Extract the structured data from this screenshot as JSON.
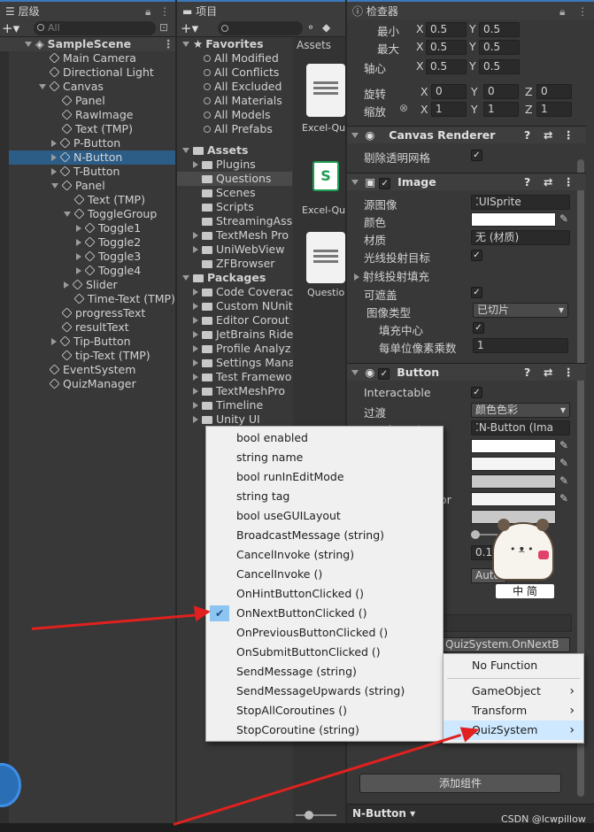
{
  "hierarchy": {
    "tab_label": "层级",
    "search_placeholder": "All",
    "scene_name": "SampleScene",
    "items": [
      {
        "label": "Main Camera",
        "indent": 0,
        "expand": "none"
      },
      {
        "label": "Directional Light",
        "indent": 0,
        "expand": "none"
      },
      {
        "label": "Canvas",
        "indent": 0,
        "expand": "open"
      },
      {
        "label": "Panel",
        "indent": 1,
        "expand": "none"
      },
      {
        "label": "RawImage",
        "indent": 1,
        "expand": "none"
      },
      {
        "label": "Text (TMP)",
        "indent": 1,
        "expand": "none"
      },
      {
        "label": "P-Button",
        "indent": 1,
        "expand": "closed"
      },
      {
        "label": "N-Button",
        "indent": 1,
        "expand": "closed",
        "selected": true
      },
      {
        "label": "T-Button",
        "indent": 1,
        "expand": "closed"
      },
      {
        "label": "Panel",
        "indent": 1,
        "expand": "open"
      },
      {
        "label": "Text (TMP)",
        "indent": 2,
        "expand": "none"
      },
      {
        "label": "ToggleGroup",
        "indent": 2,
        "expand": "open"
      },
      {
        "label": "Toggle1",
        "indent": 3,
        "expand": "closed"
      },
      {
        "label": "Toggle2",
        "indent": 3,
        "expand": "closed"
      },
      {
        "label": "Toggle3",
        "indent": 3,
        "expand": "closed"
      },
      {
        "label": "Toggle4",
        "indent": 3,
        "expand": "closed"
      },
      {
        "label": "Slider",
        "indent": 2,
        "expand": "closed"
      },
      {
        "label": "Time-Text (TMP)",
        "indent": 2,
        "expand": "none"
      },
      {
        "label": "progressText",
        "indent": 1,
        "expand": "none"
      },
      {
        "label": "resultText",
        "indent": 1,
        "expand": "none"
      },
      {
        "label": "Tip-Button",
        "indent": 1,
        "expand": "closed"
      },
      {
        "label": "tip-Text (TMP)",
        "indent": 1,
        "expand": "none"
      },
      {
        "label": "EventSystem",
        "indent": 0,
        "expand": "none"
      },
      {
        "label": "QuizManager",
        "indent": 0,
        "expand": "none"
      }
    ]
  },
  "project": {
    "tab_label": "项目",
    "favorites_label": "Favorites",
    "favorites": [
      "All Modified",
      "All Conflicts",
      "All Excluded",
      "All Materials",
      "All Models",
      "All Prefabs"
    ],
    "assets_label": "Assets",
    "assets": [
      {
        "label": "Plugins",
        "expand": "closed"
      },
      {
        "label": "Questions",
        "expand": "none",
        "selected": true
      },
      {
        "label": "Scenes",
        "expand": "none"
      },
      {
        "label": "Scripts",
        "expand": "none"
      },
      {
        "label": "StreamingAsse",
        "expand": "none"
      },
      {
        "label": "TextMesh Pro",
        "expand": "closed"
      },
      {
        "label": "UniWebView",
        "expand": "closed"
      },
      {
        "label": "ZFBrowser",
        "expand": "none"
      }
    ],
    "packages_label": "Packages",
    "packages": [
      "Code Coverac",
      "Custom NUnit",
      "Editor Corout",
      "JetBrains Ride",
      "Profile Analyz",
      "Settings Mana",
      "Test Framewo",
      "TextMeshPro",
      "Timeline",
      "Unity UI"
    ],
    "breadcrumb": "Assets",
    "files": [
      "Excel-Que",
      "Excel-Que",
      "Question"
    ]
  },
  "inspector": {
    "tab_label": "检查器",
    "rect": {
      "min_label": "最小",
      "max_label": "最大",
      "pivot_label": "轴心",
      "rotation_label": "旋转",
      "scale_label": "缩放",
      "min_x": "0.5",
      "min_y": "0.5",
      "max_x": "0.5",
      "max_y": "0.5",
      "pivot_x": "0.5",
      "pivot_y": "0.5",
      "rot_x": "0",
      "rot_y": "0",
      "rot_z": "0",
      "scale_x": "1",
      "scale_y": "1",
      "scale_z": "1",
      "x": "X",
      "y": "Y",
      "z": "Z"
    },
    "canvas_renderer": {
      "title": "Canvas Renderer",
      "cull_label": "剔除透明网格"
    },
    "image": {
      "title": "Image",
      "source_label": "源图像",
      "source_value": "UISprite",
      "color_label": "颜色",
      "material_label": "材质",
      "material_value": "无 (材质)",
      "raycast_label": "光线投射目标",
      "raycast_padding_label": "射线投射填充",
      "maskable_label": "可遮盖",
      "type_label": "图像类型",
      "type_value": "已切片",
      "fill_center_label": "填充中心",
      "ppu_label": "每单位像素乘数",
      "ppu_value": "1"
    },
    "button": {
      "title": "Button",
      "interactable_label": "Interactable",
      "transition_label": "过渡",
      "transition_value": "颜色色彩",
      "target_label": "目标图形",
      "target_value": "N-Button (Ima",
      "color_mult_partial": "or",
      "fade_value": "0.1",
      "auto_label": "Auto",
      "event_method": "QuizSystem.OnNextB"
    },
    "add_component": "添加组件",
    "footer_object": "N-Button"
  },
  "method_menu": {
    "items": [
      {
        "label": "bool enabled"
      },
      {
        "label": "string name"
      },
      {
        "label": "bool runInEditMode"
      },
      {
        "label": "string tag"
      },
      {
        "label": "bool useGUILayout"
      },
      {
        "label": "BroadcastMessage (string)"
      },
      {
        "label": "CancelInvoke (string)"
      },
      {
        "label": "CancelInvoke ()"
      },
      {
        "label": "OnHintButtonClicked ()"
      },
      {
        "label": "OnNextButtonClicked ()",
        "checked": true
      },
      {
        "label": "OnPreviousButtonClicked ()"
      },
      {
        "label": "OnSubmitButtonClicked ()"
      },
      {
        "label": "SendMessage (string)"
      },
      {
        "label": "SendMessageUpwards (string)"
      },
      {
        "label": "StopAllCoroutines ()"
      },
      {
        "label": "StopCoroutine (string)"
      }
    ]
  },
  "component_menu": {
    "items": [
      {
        "label": "No Function",
        "submenu": false
      },
      {
        "label": "GameObject",
        "submenu": true
      },
      {
        "label": "Transform",
        "submenu": true
      },
      {
        "label": "QuizSystem",
        "submenu": true,
        "selected": true
      }
    ]
  },
  "sticker_text": "中 简",
  "watermark": "CSDN @lcwpillow",
  "colors": {
    "selection": "#2c5d87",
    "menu_highlight": "#cde8ff",
    "arrow": "#e0211f",
    "accent": "#3a79bb"
  }
}
